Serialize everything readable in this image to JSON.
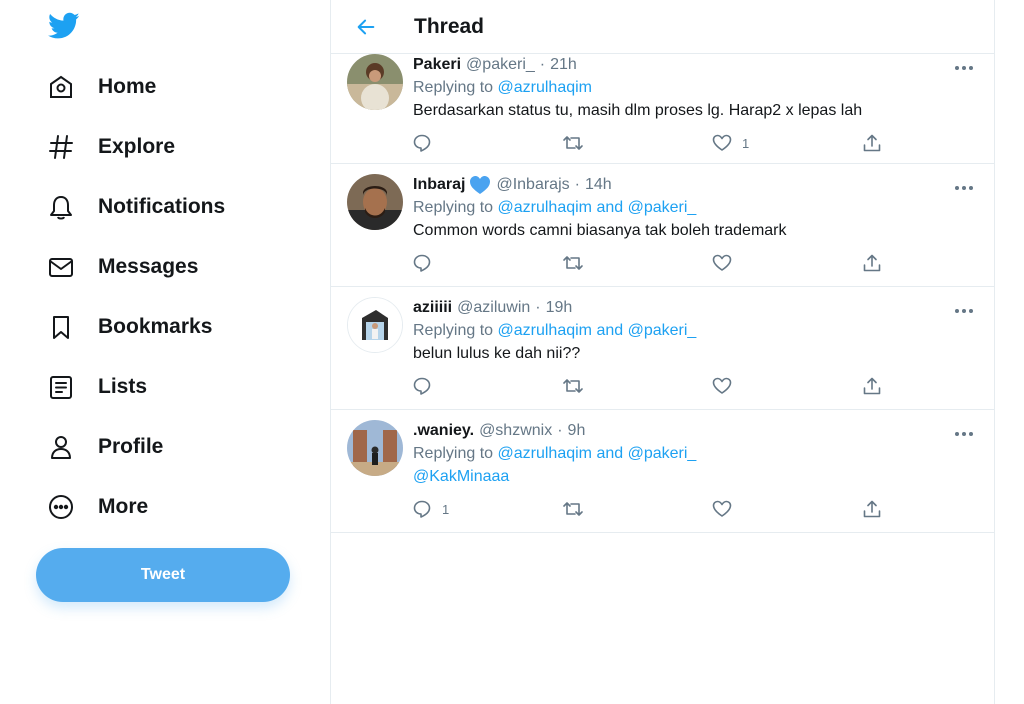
{
  "sidebar": {
    "logo": "twitter-bird-icon",
    "items": [
      {
        "label": "Home",
        "icon": "home-icon"
      },
      {
        "label": "Explore",
        "icon": "hashtag-icon"
      },
      {
        "label": "Notifications",
        "icon": "bell-icon"
      },
      {
        "label": "Messages",
        "icon": "envelope-icon"
      },
      {
        "label": "Bookmarks",
        "icon": "bookmark-icon"
      },
      {
        "label": "Lists",
        "icon": "list-icon"
      },
      {
        "label": "Profile",
        "icon": "person-icon"
      },
      {
        "label": "More",
        "icon": "more-circle-icon"
      }
    ],
    "tweet_button": "Tweet"
  },
  "header": {
    "title": "Thread"
  },
  "tweets": [
    {
      "name": "Pakeri",
      "handle": "@pakeri_",
      "dot": "·",
      "time": "21h",
      "verified": false,
      "replying_prefix": "Replying to",
      "replying_to": "@azrulhaqim",
      "replying_and": "",
      "replying_to_2": "",
      "text": "Berdasarkan status tu, masih dlm proses lg. Harap2 x lepas lah",
      "reply_count": "",
      "like_count": "1"
    },
    {
      "name": "Inbaraj",
      "handle": "@Inbarajs",
      "dot": "·",
      "time": "14h",
      "verified": true,
      "replying_prefix": "Replying to",
      "replying_to": "@azrulhaqim",
      "replying_and": "and",
      "replying_to_2": "@pakeri_",
      "text": "Common words camni biasanya tak boleh trademark",
      "reply_count": "",
      "like_count": ""
    },
    {
      "name": "aziiiii",
      "handle": "@aziluwin",
      "dot": "·",
      "time": "19h",
      "verified": false,
      "replying_prefix": "Replying to",
      "replying_to": "@azrulhaqim",
      "replying_and": "and",
      "replying_to_2": "@pakeri_",
      "text": "belun lulus ke dah nii??",
      "reply_count": "",
      "like_count": ""
    },
    {
      "name": ".waniey.",
      "handle": "@shzwnix",
      "dot": "·",
      "time": "9h",
      "verified": false,
      "replying_prefix": "Replying to",
      "replying_to": "@azrulhaqim",
      "replying_and": "and",
      "replying_to_2": "@pakeri_",
      "text_mention": "@KakMinaaa",
      "reply_count": "1",
      "like_count": ""
    }
  ],
  "colors": {
    "accent": "#1da1f2",
    "tweet_button": "#55acee",
    "text_primary": "#14171a",
    "text_secondary": "#657786",
    "border": "#e6ecf0"
  }
}
